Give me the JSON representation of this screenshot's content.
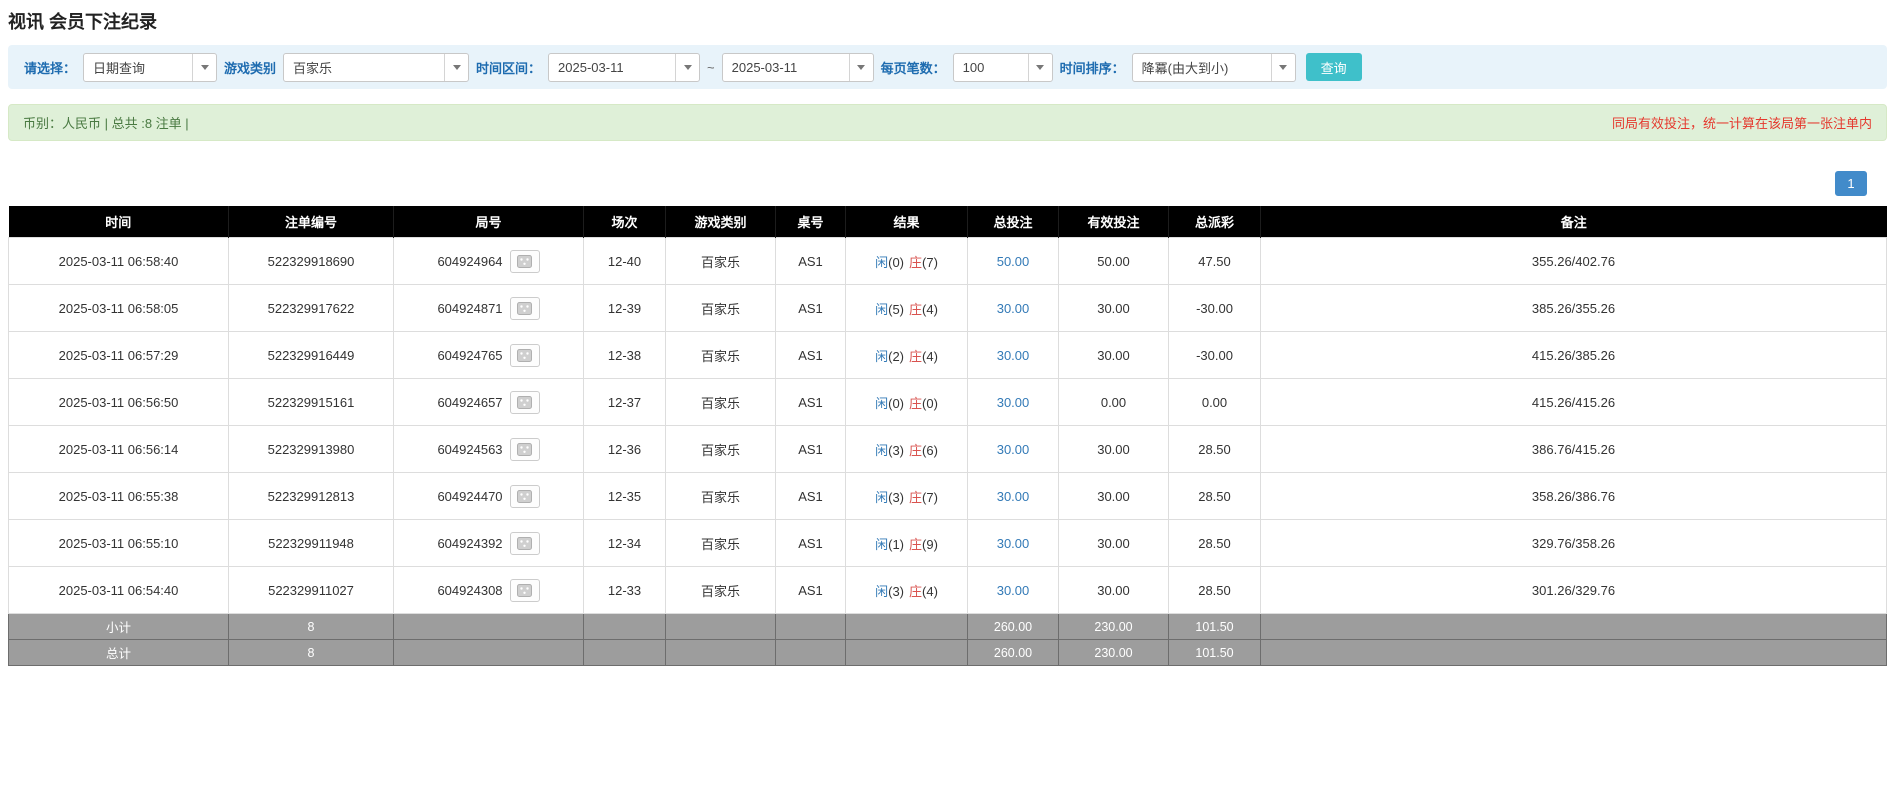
{
  "page": {
    "title": "视讯 会员下注纪录"
  },
  "filters": {
    "query_type_label": "请选择：",
    "query_type_value": "日期查询",
    "game_type_label": "游戏类别",
    "game_type_value": "百家乐",
    "time_range_label": "时间区间：",
    "date_from": "2025-03-11",
    "range_separator": "~",
    "date_to": "2025-03-11",
    "page_size_label": "每页笔数：",
    "page_size_value": "100",
    "sort_label": "时间排序：",
    "sort_value": "降冪(由大到小)",
    "search_button": "查询"
  },
  "summary": {
    "left_text": "币别：人民币 | 总共 :8 注单 |",
    "right_note": "同局有效投注，统一计算在该局第一张注单内"
  },
  "pagination": {
    "current_page": "1"
  },
  "icons": {
    "combo_caret": "chevron-down",
    "round_replay": "dice"
  },
  "table": {
    "headers": [
      "时间",
      "注单编号",
      "局号",
      "场次",
      "游戏类别",
      "桌号",
      "结果",
      "总投注",
      "有效投注",
      "总派彩",
      "备注"
    ],
    "rows": [
      {
        "time": "2025-03-11 06:58:40",
        "bet_no": "522329918690",
        "round_no": "604924964",
        "session": "12-40",
        "game": "百家乐",
        "table_no": "AS1",
        "player_label": "闲",
        "player_num": "(0)",
        "banker_label": "庄",
        "banker_num": "(7)",
        "total_bet": "50.00",
        "valid_bet": "50.00",
        "payout": "47.50",
        "payout_neg": false,
        "note": "355.26/402.76"
      },
      {
        "time": "2025-03-11 06:58:05",
        "bet_no": "522329917622",
        "round_no": "604924871",
        "session": "12-39",
        "game": "百家乐",
        "table_no": "AS1",
        "player_label": "闲",
        "player_num": "(5)",
        "banker_label": "庄",
        "banker_num": "(4)",
        "total_bet": "30.00",
        "valid_bet": "30.00",
        "payout": "-30.00",
        "payout_neg": true,
        "note": "385.26/355.26"
      },
      {
        "time": "2025-03-11 06:57:29",
        "bet_no": "522329916449",
        "round_no": "604924765",
        "session": "12-38",
        "game": "百家乐",
        "table_no": "AS1",
        "player_label": "闲",
        "player_num": "(2)",
        "banker_label": "庄",
        "banker_num": "(4)",
        "total_bet": "30.00",
        "valid_bet": "30.00",
        "payout": "-30.00",
        "payout_neg": true,
        "note": "415.26/385.26"
      },
      {
        "time": "2025-03-11 06:56:50",
        "bet_no": "522329915161",
        "round_no": "604924657",
        "session": "12-37",
        "game": "百家乐",
        "table_no": "AS1",
        "player_label": "闲",
        "player_num": "(0)",
        "banker_label": "庄",
        "banker_num": "(0)",
        "total_bet": "30.00",
        "valid_bet": "0.00",
        "payout": "0.00",
        "payout_neg": false,
        "note": "415.26/415.26"
      },
      {
        "time": "2025-03-11 06:56:14",
        "bet_no": "522329913980",
        "round_no": "604924563",
        "session": "12-36",
        "game": "百家乐",
        "table_no": "AS1",
        "player_label": "闲",
        "player_num": "(3)",
        "banker_label": "庄",
        "banker_num": "(6)",
        "total_bet": "30.00",
        "valid_bet": "30.00",
        "payout": "28.50",
        "payout_neg": false,
        "note": "386.76/415.26"
      },
      {
        "time": "2025-03-11 06:55:38",
        "bet_no": "522329912813",
        "round_no": "604924470",
        "session": "12-35",
        "game": "百家乐",
        "table_no": "AS1",
        "player_label": "闲",
        "player_num": "(3)",
        "banker_label": "庄",
        "banker_num": "(7)",
        "total_bet": "30.00",
        "valid_bet": "30.00",
        "payout": "28.50",
        "payout_neg": false,
        "note": "358.26/386.76"
      },
      {
        "time": "2025-03-11 06:55:10",
        "bet_no": "522329911948",
        "round_no": "604924392",
        "session": "12-34",
        "game": "百家乐",
        "table_no": "AS1",
        "player_label": "闲",
        "player_num": "(1)",
        "banker_label": "庄",
        "banker_num": "(9)",
        "total_bet": "30.00",
        "valid_bet": "30.00",
        "payout": "28.50",
        "payout_neg": false,
        "note": "329.76/358.26"
      },
      {
        "time": "2025-03-11 06:54:40",
        "bet_no": "522329911027",
        "round_no": "604924308",
        "session": "12-33",
        "game": "百家乐",
        "table_no": "AS1",
        "player_label": "闲",
        "player_num": "(3)",
        "banker_label": "庄",
        "banker_num": "(4)",
        "total_bet": "30.00",
        "valid_bet": "30.00",
        "payout": "28.50",
        "payout_neg": false,
        "note": "301.26/329.76"
      }
    ],
    "footer": [
      {
        "label": "小计",
        "count": "8",
        "total_bet": "260.00",
        "valid_bet": "230.00",
        "payout": "101.50"
      },
      {
        "label": "总计",
        "count": "8",
        "total_bet": "260.00",
        "valid_bet": "230.00",
        "payout": "101.50"
      }
    ]
  },
  "colors": {
    "label_blue": "#1e6cb0",
    "filter_bg": "#e8f3fa",
    "search_teal": "#3fc0ca",
    "summary_bg": "#dff0d8",
    "summary_border": "#d6e9c6",
    "summary_green": "#4a7a42",
    "note_red": "#e5392e",
    "link_blue": "#337ab7",
    "banker_red": "#d9534f",
    "negative_red": "#e02b20",
    "page_blue": "#428bca",
    "header_bg": "#000000",
    "footer_bg": "#9d9d9d"
  }
}
